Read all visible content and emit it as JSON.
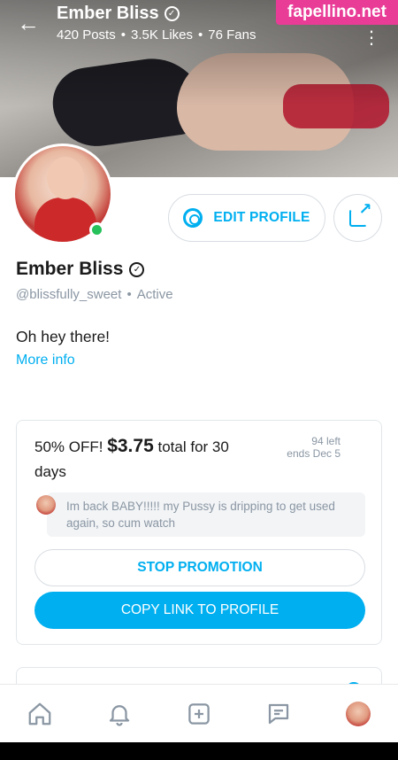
{
  "header": {
    "title": "Ember Bliss",
    "posts": "420 Posts",
    "likes": "3.5K Likes",
    "fans": "76 Fans",
    "separator": "•",
    "watermark": "fapellino.net"
  },
  "profile": {
    "name": "Ember Bliss",
    "handle": "@blissfully_sweet",
    "status": "Active",
    "bio": "Oh hey there!",
    "more_info": "More info",
    "edit_label": "EDIT PROFILE"
  },
  "promotion": {
    "offer": "50% OFF!",
    "price": "$3.75",
    "duration": "total for 30 days",
    "left": "94 left",
    "ends": "ends Dec 5",
    "message": "Im back BABY!!!!! my Pussy is dripping to get used again, so cum watch",
    "stop_label": "STOP PROMOTION",
    "copy_label": "COPY LINK TO PROFILE"
  },
  "nav": {
    "items": [
      "home-icon",
      "bell-icon",
      "add-post-icon",
      "messages-icon",
      "profile-avatar"
    ]
  },
  "colors": {
    "accent": "#00aff0",
    "online": "#26c15a",
    "watermark_bg": "#e93c97"
  }
}
